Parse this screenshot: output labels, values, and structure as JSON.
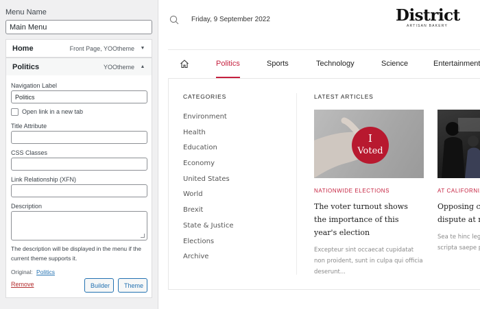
{
  "admin": {
    "menu_name_label": "Menu Name",
    "menu_name_value": "Main Menu",
    "items": [
      {
        "title": "Home",
        "meta": "Front Page, YOOtheme",
        "arrow": "▼"
      },
      {
        "title": "Politics",
        "meta": "YOOtheme",
        "arrow": "▲"
      }
    ],
    "settings": {
      "nav_label_label": "Navigation Label",
      "nav_label_value": "Politics",
      "new_tab_label": "Open link in a new tab",
      "title_attr_label": "Title Attribute",
      "css_classes_label": "CSS Classes",
      "link_rel_label": "Link Relationship (XFN)",
      "description_label": "Description",
      "description_help": "The description will be displayed in the menu if the current theme supports it.",
      "original_label": "Original:",
      "original_link": "Politics",
      "remove_label": "Remove",
      "builder_label": "Builder",
      "theme_label": "Theme"
    }
  },
  "site": {
    "date": "Friday, 9 September 2022",
    "logo_name": "District",
    "logo_sub": "ARTISAN BAKERY",
    "nav": [
      "Politics",
      "Sports",
      "Technology",
      "Science",
      "Entertainment"
    ],
    "active_nav": "Politics",
    "accent_color": "#c5203e",
    "categories_heading": "CATEGORIES",
    "categories": [
      "Environment",
      "Health",
      "Education",
      "Economy",
      "United States",
      "World",
      "Brexit",
      "State & Justice",
      "Elections",
      "Archive"
    ],
    "latest_heading": "LATEST ARTICLES",
    "articles": [
      {
        "badge_top": "I",
        "badge_bottom": "Voted",
        "category": "NATIONWIDE ELECTIONS",
        "title": "The voter turnout shows the importance of this year's election",
        "excerpt": "Excepteur sint occaecat cupidatat non proident, sunt in culpa qui officia deserunt..."
      },
      {
        "category": "AT CALIFORNIA",
        "title": "Opposing camps in heated dispute at rally",
        "excerpt": "Sea te hinc legere per et dicat scripta saepe possim"
      }
    ]
  }
}
